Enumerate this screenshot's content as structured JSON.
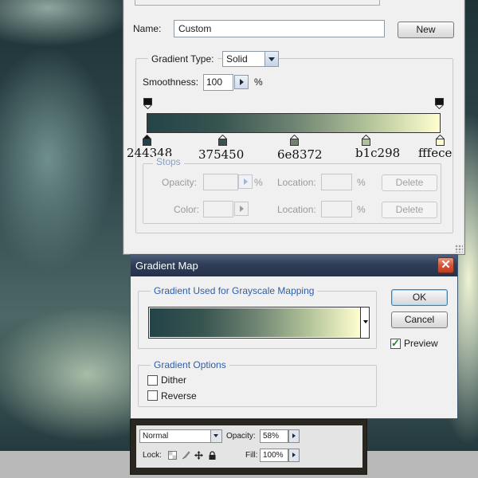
{
  "gradient_editor": {
    "name_label": "Name:",
    "name_value": "Custom",
    "new_button": "New",
    "gradient_type_label": "Gradient Type:",
    "gradient_type_value": "Solid",
    "smoothness_label": "Smoothness:",
    "smoothness_value": "100",
    "smoothness_unit": "%",
    "gradient_colors": [
      "#244348",
      "#375450",
      "#6e8372",
      "#b1c298",
      "#fffece"
    ],
    "stop_labels": [
      "244348",
      "375450",
      "6e8372",
      "b1c298",
      "fffece"
    ],
    "stops": {
      "title": "Stops",
      "opacity_label": "Opacity:",
      "opacity_unit": "%",
      "location_label": "Location:",
      "location_unit": "%",
      "delete_label": "Delete",
      "color_label": "Color:"
    }
  },
  "gradient_map": {
    "title": "Gradient Map",
    "close_icon": "close-icon",
    "mapping_group_title": "Gradient Used for Grayscale Mapping",
    "ok_button": "OK",
    "cancel_button": "Cancel",
    "preview_label": "Preview",
    "preview_checked": true,
    "options_group_title": "Gradient Options",
    "dither_label": "Dither",
    "dither_checked": false,
    "reverse_label": "Reverse",
    "reverse_checked": false
  },
  "layers_panel": {
    "blend_mode": "Normal",
    "opacity_label": "Opacity:",
    "opacity_value": "58%",
    "lock_label": "Lock:",
    "fill_label": "Fill:",
    "fill_value": "100%",
    "lock_icons": [
      "lock-transparent-icon",
      "lock-brush-icon",
      "lock-move-icon",
      "lock-all-icon"
    ]
  }
}
